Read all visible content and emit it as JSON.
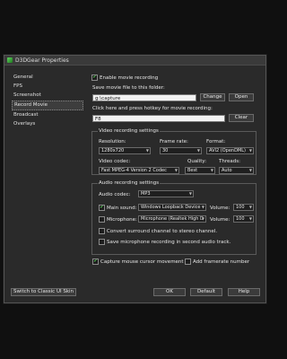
{
  "window": {
    "title": "D3DGear Properties"
  },
  "sidebar": {
    "items": [
      {
        "label": "General"
      },
      {
        "label": "FPS"
      },
      {
        "label": "Screenshot"
      },
      {
        "label": "Record Movie"
      },
      {
        "label": "Broadcast"
      },
      {
        "label": "Overlays"
      }
    ],
    "selected": "Record Movie"
  },
  "record": {
    "enable_label": "Enable movie recording",
    "enable_checked": true,
    "save_folder_label": "Save movie file to this folder:",
    "save_folder_value": "g:\\capture",
    "change_button": "Change",
    "open_button": "Open",
    "hotkey_label": "Click here and press hotkey for movie recording:",
    "hotkey_value": "F8",
    "clear_button": "Clear"
  },
  "video": {
    "group_title": "Video recording settings",
    "resolution_label": "Resolution:",
    "resolution_value": "1280x720",
    "framerate_label": "Frame rate:",
    "framerate_value": "30",
    "format_label": "Format:",
    "format_value": "AVI2 (OpenDML)",
    "codec_label": "Video codec:",
    "codec_value": "Fast MPEG-4 Version 2 Codec",
    "quality_label": "Quality:",
    "quality_value": "Best",
    "threads_label": "Threads:",
    "threads_value": "Auto"
  },
  "audio": {
    "group_title": "Audio recording settings",
    "codec_label": "Audio codec:",
    "codec_value": "MP3",
    "main_sound_label": "Main sound:",
    "main_sound_checked": true,
    "main_sound_device": "Windows Loopback Device",
    "main_volume_label": "Volume:",
    "main_volume_value": "100",
    "microphone_label": "Microphone:",
    "microphone_checked": false,
    "microphone_device": "Microphone (Realtek High D",
    "mic_volume_label": "Volume:",
    "mic_volume_value": "100",
    "surround_label": "Convert surround channel to stereo channel.",
    "surround_checked": false,
    "separate_track_label": "Save microphone recording in second audio track.",
    "separate_track_checked": false
  },
  "options": {
    "capture_cursor_label": "Capture mouse cursor movement",
    "capture_cursor_checked": true,
    "framerate_number_label": "Add framerate number",
    "framerate_number_checked": false
  },
  "footer": {
    "classic_skin_button": "Switch to Classic UI Skin",
    "ok_button": "OK",
    "default_button": "Default",
    "help_button": "Help"
  },
  "colors": {
    "accent_check": "#5fd35f",
    "window_bg": "#2a2a2a",
    "screen_bg": "#101010"
  }
}
